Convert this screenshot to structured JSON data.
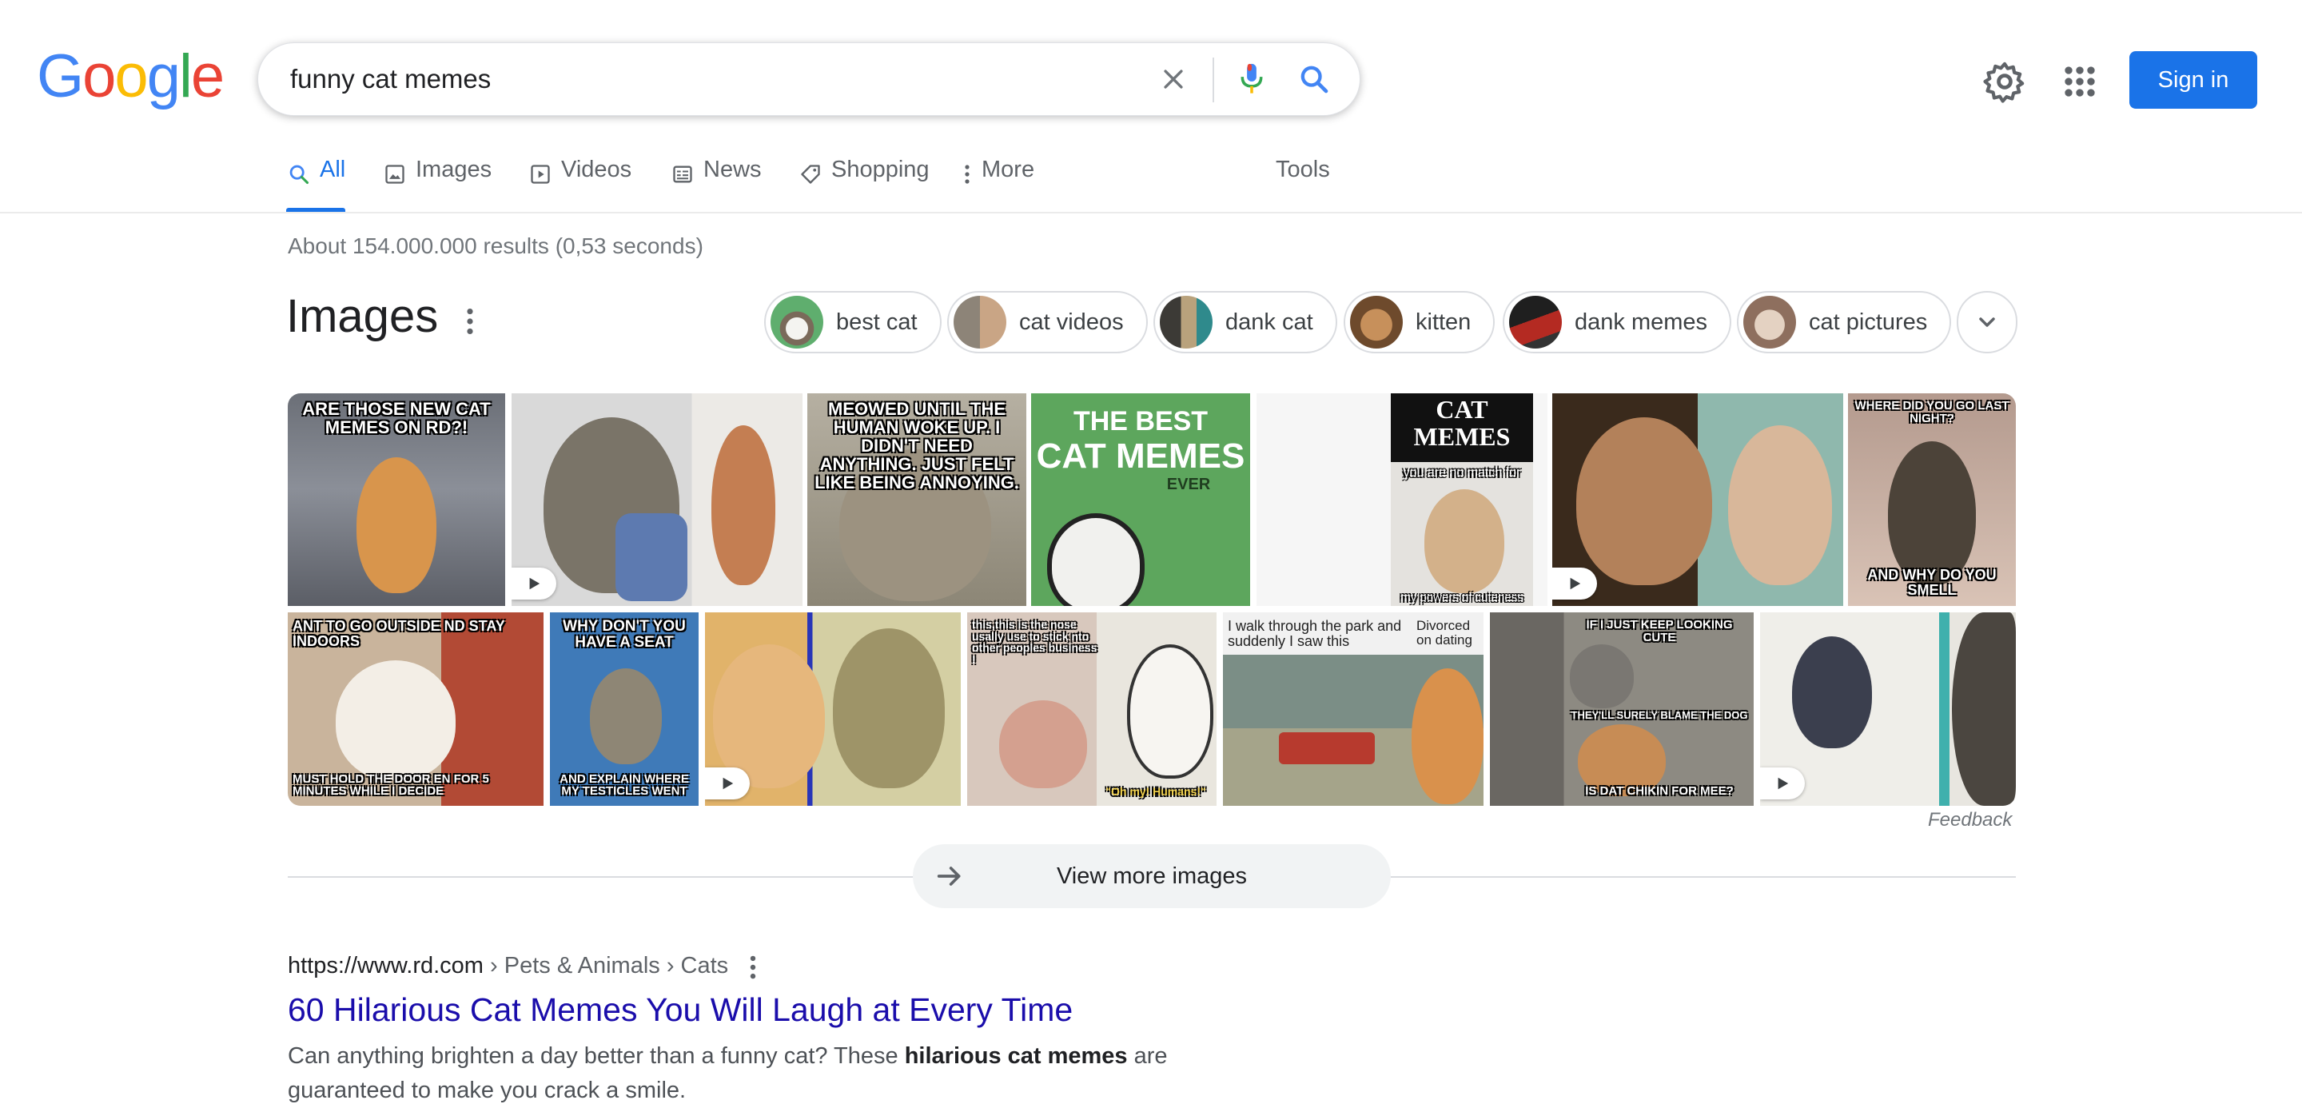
{
  "logo": {
    "text": "Google"
  },
  "search": {
    "query": "funny cat memes",
    "clear_icon": "close-icon",
    "voice_icon": "microphone-icon",
    "search_icon": "search-icon"
  },
  "header": {
    "settings_icon": "gear-icon",
    "apps_icon": "apps-grid-icon",
    "sign_in": "Sign in"
  },
  "tabs": [
    {
      "label": "All",
      "icon": "search-icon",
      "active": true
    },
    {
      "label": "Images",
      "icon": "image-icon"
    },
    {
      "label": "Videos",
      "icon": "play-icon"
    },
    {
      "label": "News",
      "icon": "news-icon"
    },
    {
      "label": "Shopping",
      "icon": "tag-icon"
    },
    {
      "label": "More",
      "icon": "vertical-dots-icon"
    },
    {
      "label": "Tools"
    }
  ],
  "stats": "About 154.000.000 results (0,53 seconds)",
  "images_section": {
    "title": "Images",
    "chips": [
      "best cat",
      "cat videos",
      "dank cat",
      "kitten",
      "dank memes",
      "cat pictures"
    ],
    "feedback": "Feedback",
    "view_more": "View more images",
    "captions": {
      "t1": "ARE THOSE NEW CAT MEMES ON RD?!",
      "t3": "MEOWED UNTIL THE HUMAN WOKE UP. I DIDN'T NEED ANYTHING. JUST FELT LIKE BEING ANNOYING.",
      "t4a": "THE BEST",
      "t4b": "CAT MEMES",
      "t4c": "EVER",
      "t5a": "CAT MEMES",
      "t5b": "you are no match for",
      "t5c": "my powers of cuteness",
      "t7a": "WHERE DID YOU GO LAST NIGHT?",
      "t7b": "AND WHY DO YOU SMELL",
      "t8a": "ANT TO GO OUTSIDE ND STAY INDOORS",
      "t8b": "MUST HOLD THE DOOR EN FOR 5 MINUTES WHILE I DECIDE",
      "t9a": "WHY DON'T YOU HAVE A SEAT",
      "t9b": "AND EXPLAIN WHERE MY TESTICLES WENT",
      "t11a": "this,this is the nose usally use to stick nto other peoples business !",
      "t11b": "\"Oh my! Humans!\"",
      "t12a": "I walk through the park and suddenly I saw this",
      "t12b": "Divorced on dating",
      "t13a": "IF I JUST KEEP LOOKING CUTE",
      "t13b": "THEY'LL SURELY BLAME THE DOG",
      "t13c": "IS DAT CHIKIN FOR MEE?"
    }
  },
  "result": {
    "url": "https://www.rd.com",
    "breadcrumbs": " › Pets & Animals › Cats",
    "title": "60 Hilarious Cat Memes You Will Laugh at Every Time",
    "snippet_pre": "Can anything brighten a day better than a funny cat? These ",
    "snippet_bold": "hilarious cat memes",
    "snippet_post": " are guaranteed to make you crack a smile."
  },
  "colors": {
    "accent": "#1a73e8",
    "link": "#1a0dab",
    "muted": "#70757a"
  }
}
